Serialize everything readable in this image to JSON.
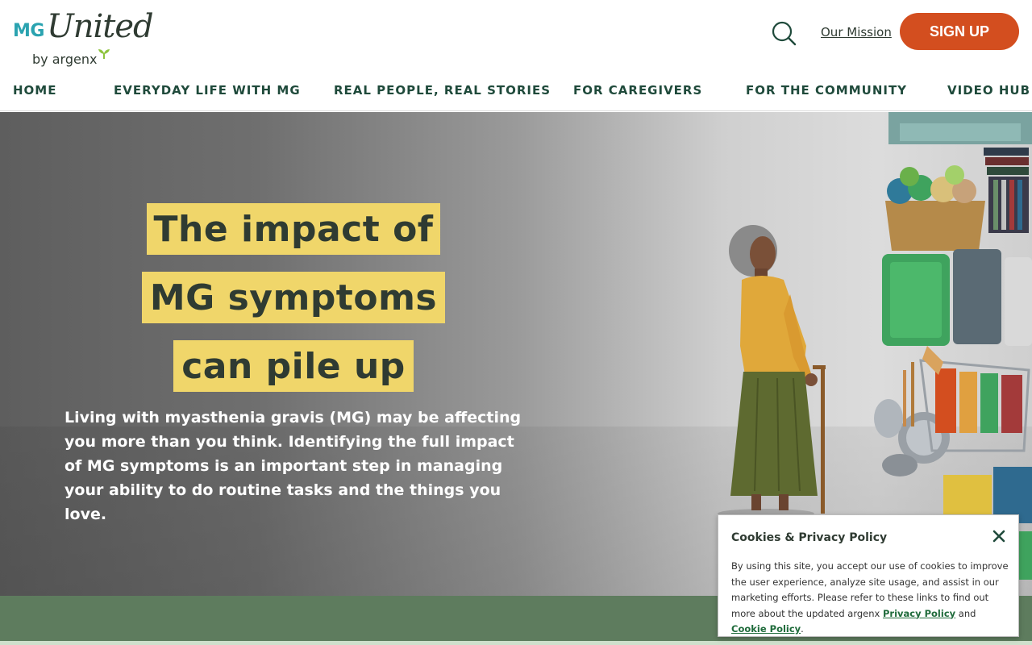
{
  "header": {
    "logo_mg": "MG",
    "logo_united": "United",
    "logo_by": "by argenx",
    "mission_link": "Our Mission",
    "signup_label": "SIGN UP"
  },
  "nav": {
    "items": [
      {
        "label": "HOME"
      },
      {
        "label": "EVERYDAY LIFE WITH MG"
      },
      {
        "label": "REAL PEOPLE, REAL STORIES"
      },
      {
        "label": "FOR CAREGIVERS"
      },
      {
        "label": "FOR THE COMMUNITY"
      },
      {
        "label": "VIDEO HUB"
      }
    ]
  },
  "hero": {
    "headline_lines": [
      "The impact of",
      "MG symptoms",
      "can pile up"
    ],
    "description": "Living with myasthenia gravis (MG) may be affecting you more than you think. Identifying the full impact of MG symptoms is an important step in managing your ability to do routine tasks and the things you love."
  },
  "cookie": {
    "title": "Cookies & Privacy Policy",
    "body_prefix": "By using this site, you accept our use of cookies to improve the user experience, analyze site usage, and assist in our marketing efforts. Please refer to these links to find out more about the updated argenx ",
    "privacy_link": "Privacy Policy",
    "and_text": " and ",
    "cookie_link": "Cookie Policy",
    "suffix": "."
  },
  "colors": {
    "brand_teal": "#2ba3b0",
    "brand_dark": "#2f3b32",
    "nav_green": "#1f4a3b",
    "signup_orange": "#d34e1f",
    "headline_yellow": "#f0d66a",
    "band_green": "#5e7c5e"
  },
  "icons": [
    "search-icon",
    "close-icon",
    "leaf-icon"
  ]
}
